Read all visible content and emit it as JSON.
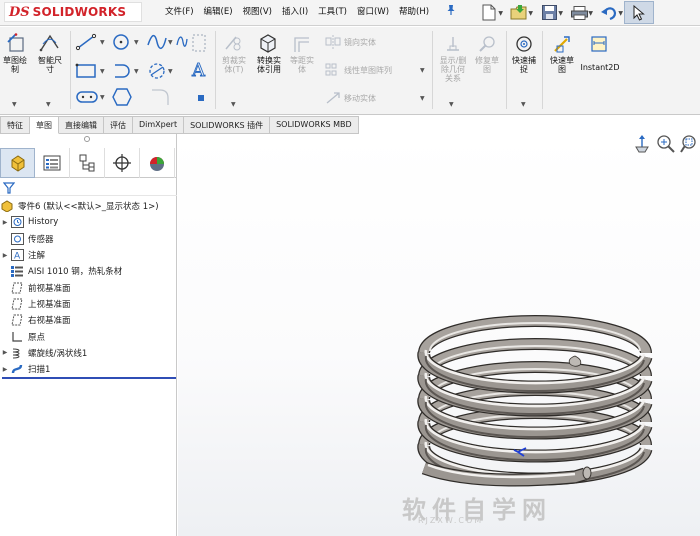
{
  "app": {
    "logo_prefix": "DS",
    "logo_text": "SOLIDWORKS"
  },
  "menu": [
    "文件(F)",
    "编辑(E)",
    "视图(V)",
    "插入(I)",
    "工具(T)",
    "窗口(W)",
    "帮助(H)"
  ],
  "ribbon": {
    "sketch": "草图绘\n制",
    "smart_dim": "智能尺\n寸",
    "trim": "剪裁实\n体(T)",
    "convert": "转换实\n体引用",
    "offset": "等距实\n体",
    "mirror": "镜向实体",
    "linear_pattern": "线性草图阵列",
    "move": "移动实体",
    "show_relations": "显示/删\n除几何\n关系",
    "repair": "修复草\n图",
    "quick_snap": "快速捕\n捉",
    "rapid_sketch": "快速草\n图",
    "instant2d": "Instant2D"
  },
  "tabs": [
    "特征",
    "草图",
    "直接编辑",
    "评估",
    "DimXpert",
    "SOLIDWORKS 插件",
    "SOLIDWORKS MBD"
  ],
  "tree": {
    "root": "零件6 (默认<<默认>_显示状态 1>)",
    "items": [
      {
        "label": "History",
        "expand": true
      },
      {
        "label": "传感器",
        "expand": false
      },
      {
        "label": "注解",
        "expand": true
      },
      {
        "label": "AISI 1010 钢，热轧条材",
        "expand": false
      },
      {
        "label": "前视基准面",
        "expand": false
      },
      {
        "label": "上视基准面",
        "expand": false
      },
      {
        "label": "右视基准面",
        "expand": false
      },
      {
        "label": "原点",
        "expand": false
      },
      {
        "label": "螺旋线/涡状线1",
        "expand": true
      },
      {
        "label": "扫描1",
        "expand": true
      }
    ]
  },
  "watermark": {
    "main": "软件自学网",
    "url": "RJZXW.COM"
  },
  "colors": {
    "brand": "#d2232a",
    "accent": "#2a6ac2",
    "rollback": "#2f4db5"
  }
}
